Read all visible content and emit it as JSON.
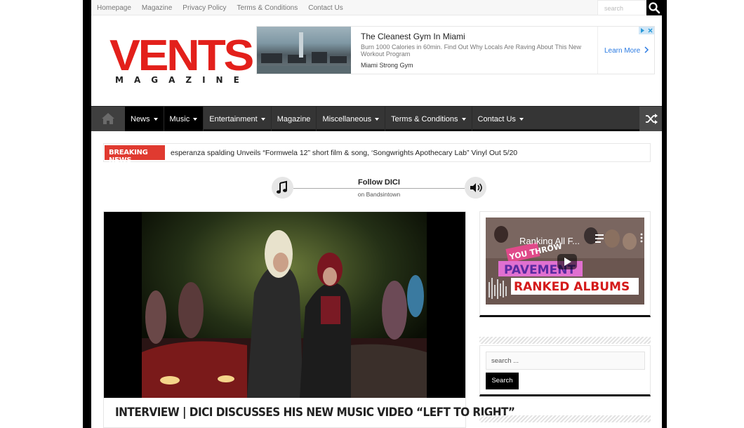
{
  "topbar": {
    "links": [
      "Homepage",
      "Magazine",
      "Privacy Policy",
      "Terms & Conditions",
      "Contact Us"
    ],
    "search_placeholder": "search"
  },
  "logo": {
    "main": "VENTS",
    "sub": "MAGAZINE"
  },
  "ad": {
    "title": "The Cleanest Gym In Miami",
    "description": "Burn 1000 Calories in 60min. Find Out Why Locals Are Raving About This New Workout Program",
    "brand": "Miami Strong Gym",
    "cta": "Learn More"
  },
  "nav": {
    "items": [
      {
        "label": "News",
        "dropdown": true,
        "active": true
      },
      {
        "label": "Music",
        "dropdown": true,
        "active": true
      },
      {
        "label": "Entertainment",
        "dropdown": true,
        "active": false
      },
      {
        "label": "Magazine",
        "dropdown": false,
        "active": false
      },
      {
        "label": "Miscellaneous",
        "dropdown": true,
        "active": false
      },
      {
        "label": "Terms & Conditions",
        "dropdown": true,
        "active": false
      },
      {
        "label": "Contact Us",
        "dropdown": true,
        "active": false
      }
    ]
  },
  "breaking": {
    "label": "BREAKING NEWS",
    "text": "esperanza spalding Unveils “Formwela 12” short film & song, ‘Songwrights Apothecary Lab” Vinyl Out 5/20"
  },
  "follow": {
    "title": "Follow DICI",
    "subtitle": "on Bandsintown"
  },
  "article": {
    "title": "INTERVIEW | DICI DISCUSSES HIS NEW MUSIC VIDEO “LEFT TO RIGHT”"
  },
  "sidebar": {
    "video": {
      "title": "Ranking All F...",
      "overlay_lines": [
        "YOU THROW",
        "PAVEMENT",
        "RANKED ALBUMS"
      ]
    },
    "search": {
      "placeholder": "search ...",
      "button": "Search"
    }
  },
  "colors": {
    "brand_red": "#e3201b",
    "nav_bg": "#353535",
    "breaking_red": "#e03a30",
    "ad_link": "#2a7ae2"
  }
}
